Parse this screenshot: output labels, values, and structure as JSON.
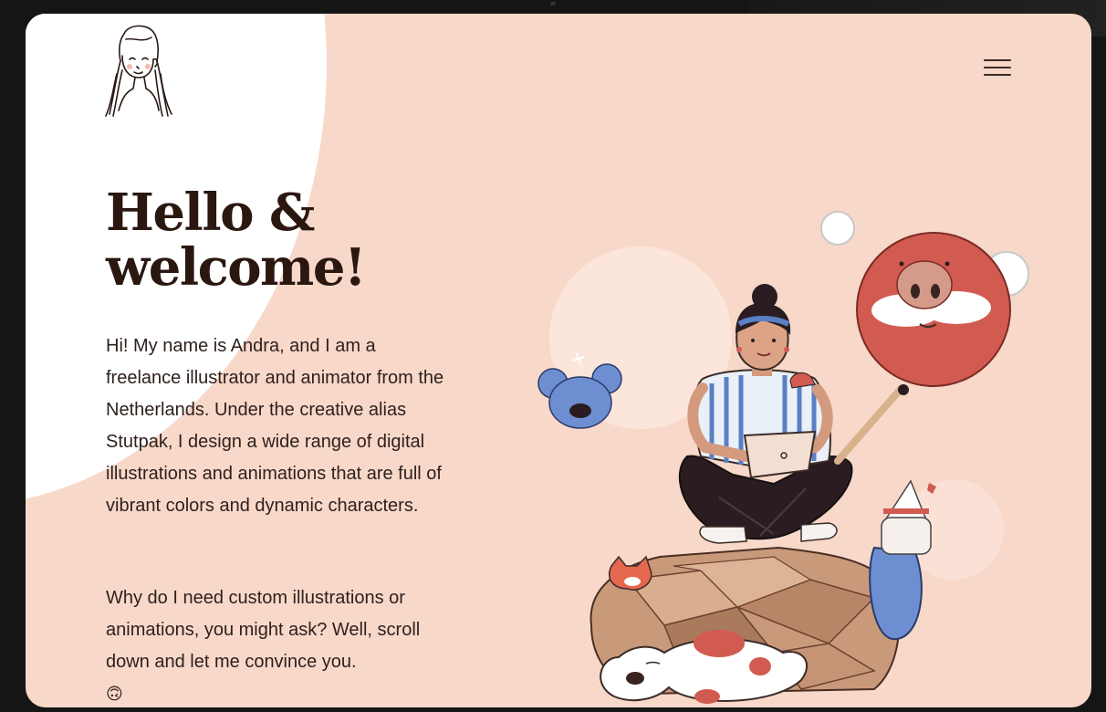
{
  "hero": {
    "headline_line1": "Hello &",
    "headline_line2": "welcome!",
    "intro_paragraph": "Hi! My name is Andra, and I am a freelance illustrator and animator from the Netherlands. Under the creative alias Stutpak, I design a wide range of digital illustrations and animations that are full of vibrant colors and dynamic characters.",
    "question_paragraph": "Why do I need custom illustrations or animations, you might ask? Well, scroll down and let me convince you.",
    "emoji": "🙃"
  },
  "header": {
    "logo_icon": "girl-portrait-logo-icon",
    "menu_icon": "hamburger-menu-icon"
  },
  "colors": {
    "background": "#f8d8c9",
    "blob": "#ffffff",
    "text": "#2a1710"
  },
  "illustration": {
    "subject": "hero-illustration-girl-on-rock"
  }
}
